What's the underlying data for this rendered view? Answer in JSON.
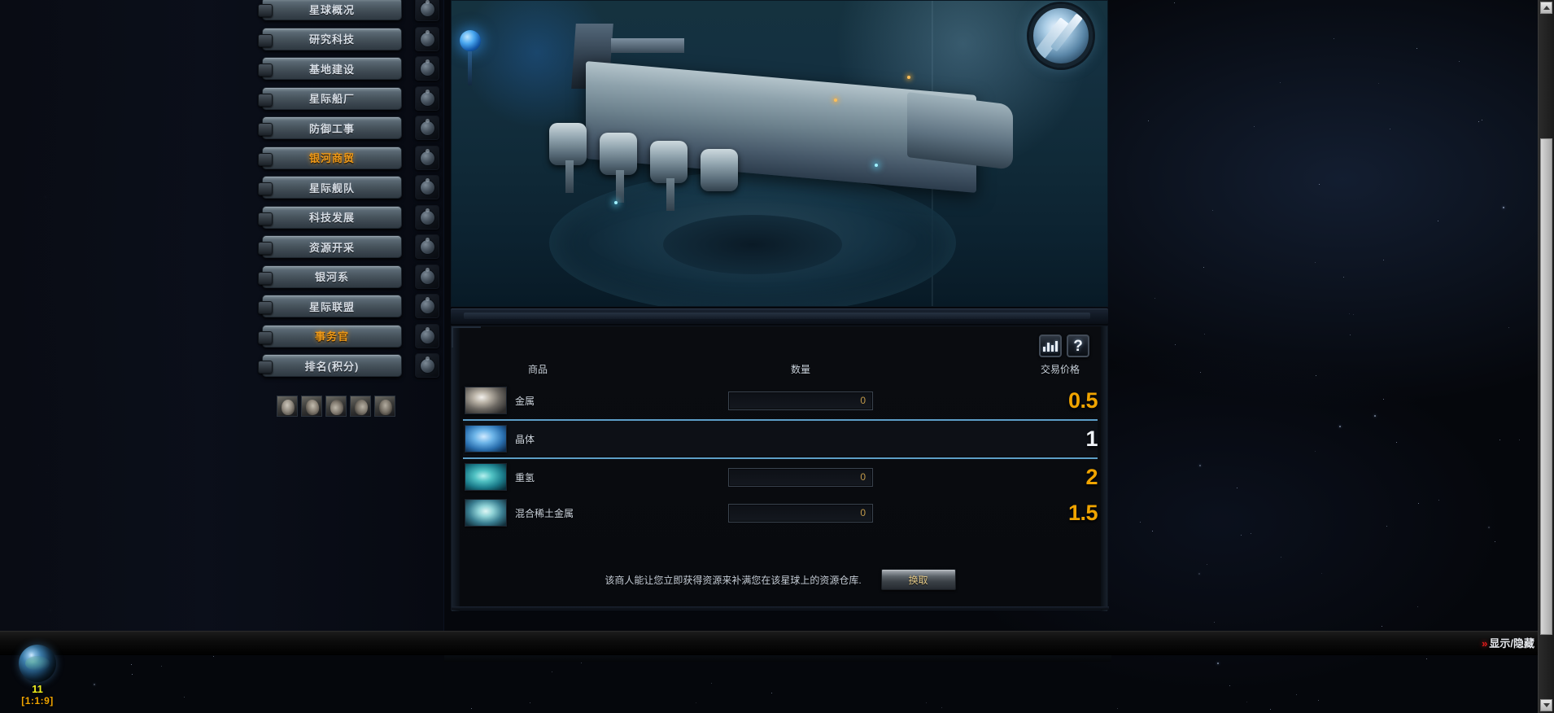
{
  "sidebar": {
    "menu_items": [
      {
        "label": "星球概况",
        "active": false
      },
      {
        "label": "研究科技",
        "active": false
      },
      {
        "label": "基地建设",
        "active": false
      },
      {
        "label": "星际船厂",
        "active": false
      },
      {
        "label": "防御工事",
        "active": false
      },
      {
        "label": "银河商贸",
        "active": true
      },
      {
        "label": "星际舰队",
        "active": false
      },
      {
        "label": "科技发展",
        "active": false
      },
      {
        "label": "资源开采",
        "active": false
      },
      {
        "label": "银河系",
        "active": false
      },
      {
        "label": "星际联盟",
        "active": false
      },
      {
        "label": "事务官",
        "active": true
      },
      {
        "label": "排名(积分)",
        "active": false
      }
    ],
    "avatars": [
      {
        "name": "avatar-1"
      },
      {
        "name": "avatar-2"
      },
      {
        "name": "avatar-3"
      },
      {
        "name": "avatar-4"
      },
      {
        "name": "avatar-5"
      }
    ]
  },
  "banner": {
    "alt": "space-station-hangar-artwork",
    "icons": [
      "blue-sphere-lamp-icon",
      "porthole-window-icon"
    ]
  },
  "trade_panel": {
    "tools": [
      {
        "name": "price-chart-icon",
        "label": ""
      },
      {
        "name": "help-question-icon",
        "label": "?"
      }
    ],
    "columns": {
      "item": "商品",
      "quantity": "数量",
      "price": "交易价格"
    },
    "rows": [
      {
        "icon": "metal-resource-icon",
        "name": "金属",
        "qty": "0",
        "qty_placeholder": "0",
        "price": "0.5",
        "price_color": "#f0a400",
        "has_input": true,
        "highlighted": false
      },
      {
        "icon": "crystal-resource-icon",
        "name": "晶体",
        "qty": "",
        "qty_placeholder": "",
        "price": "1",
        "price_color": "#f1f4f8",
        "has_input": false,
        "highlighted": true
      },
      {
        "icon": "deuterium-resource-icon",
        "name": "重氢",
        "qty": "0",
        "qty_placeholder": "0",
        "price": "2",
        "price_color": "#f0a400",
        "has_input": true,
        "highlighted": false
      },
      {
        "icon": "rare-earth-resource-icon",
        "name": "混合稀土金属",
        "qty": "0",
        "qty_placeholder": "0",
        "price": "1.5",
        "price_color": "#f0a400",
        "has_input": true,
        "highlighted": false
      }
    ],
    "footer_note": "该商人能让您立即获得资源来补满您在该星球上的资源仓库.",
    "exchange_label": "换取"
  },
  "status_bar": {
    "toggle_chevron": "»",
    "toggle_label": "显示/隐藏"
  },
  "planet": {
    "name": "11",
    "coords": "[1:1:9]"
  },
  "colors": {
    "accent_orange": "#f0a400",
    "menu_active": "#f09a18",
    "row_divider": "#5d9ec7",
    "coords_orange": "#f0a400",
    "planet_yellow": "#f3f11a",
    "toggle_red": "#e01b1b"
  }
}
